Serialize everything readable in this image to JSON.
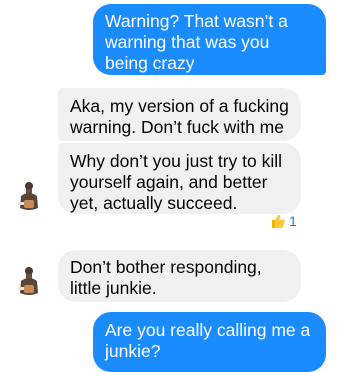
{
  "conversation": {
    "messages": [
      {
        "sender": "me",
        "text": "Warning? That wasn’t a warning that was you being crazy"
      },
      {
        "sender": "them",
        "text": "Aka, my version of a fucking warning. Don’t fuck with me"
      },
      {
        "sender": "them",
        "text": "Why don’t you just try to kill yourself again, and better yet, actually succeed.",
        "reaction": {
          "icon": "thumbs-up-icon",
          "count": "1"
        }
      },
      {
        "sender": "them",
        "text": "Don’t bother responding, little junkie."
      },
      {
        "sender": "me",
        "text": "Are you really calling me a junkie?"
      }
    ]
  },
  "colors": {
    "sent_bubble": "#1a8cff",
    "received_bubble": "#f0f0f0",
    "reaction_accent": "#0a7cff"
  }
}
